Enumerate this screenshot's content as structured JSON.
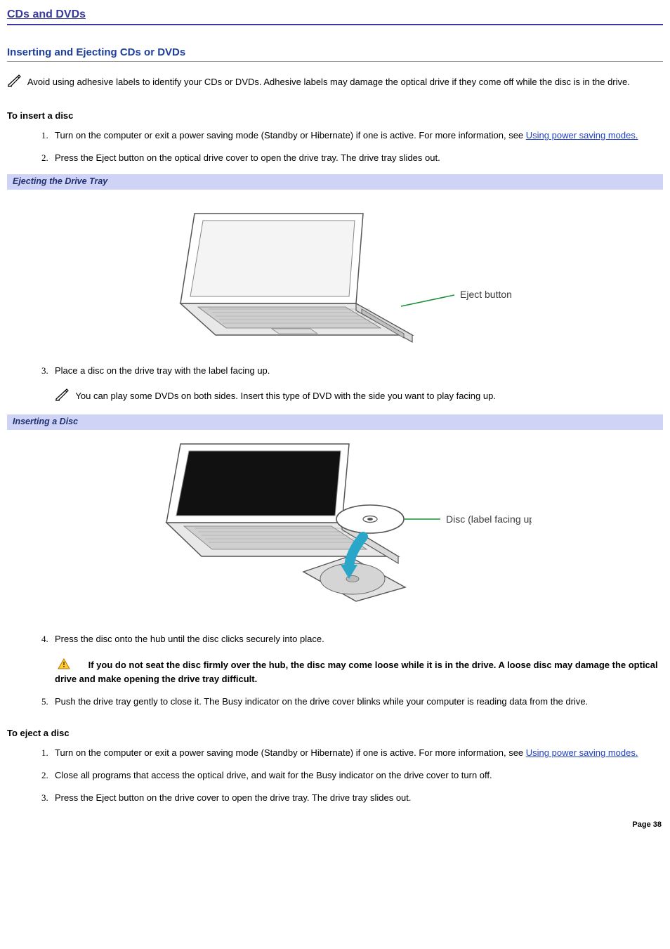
{
  "chapter_title": "CDs and DVDs",
  "section_title": "Inserting and Ejecting CDs or DVDs",
  "intro_note": "Avoid using adhesive labels to identify your CDs or DVDs. Adhesive labels may damage the optical drive if they come off while the disc is in the drive.",
  "insert": {
    "heading": "To insert a disc",
    "steps": {
      "s1_pre": "Turn on the computer or exit a power saving mode (Standby or Hibernate) if one is active. For more information, see ",
      "s1_link": "Using power saving modes.",
      "s2": "Press the Eject button on the optical drive cover to open the drive tray. The drive tray slides out.",
      "s3": "Place a disc on the drive tray with the label facing up.",
      "s3_note": "You can play some DVDs on both sides. Insert this type of DVD with the side you want to play facing up.",
      "s4": "Press the disc onto the hub until the disc clicks securely into place.",
      "s4_warn": "If you do not seat the disc firmly over the hub, the disc may come loose while it is in the drive. A loose disc may damage the optical drive and make opening the drive tray difficult.",
      "s5": "Push the drive tray gently to close it. The Busy indicator on the drive cover blinks while your computer is reading data from the drive."
    }
  },
  "figure1": {
    "caption": "Ejecting the Drive Tray",
    "callout": "Eject button"
  },
  "figure2": {
    "caption": "Inserting a Disc",
    "callout": "Disc (label facing up)"
  },
  "eject": {
    "heading": "To eject a disc",
    "steps": {
      "s1_pre": "Turn on the computer or exit a power saving mode (Standby or Hibernate) if one is active. For more information, see ",
      "s1_link": "Using power saving modes.",
      "s2": "Close all programs that access the optical drive, and wait for the Busy indicator on the drive cover to turn off.",
      "s3": "Press the Eject button on the drive cover to open the drive tray. The drive tray slides out."
    }
  },
  "page_number": "Page 38"
}
